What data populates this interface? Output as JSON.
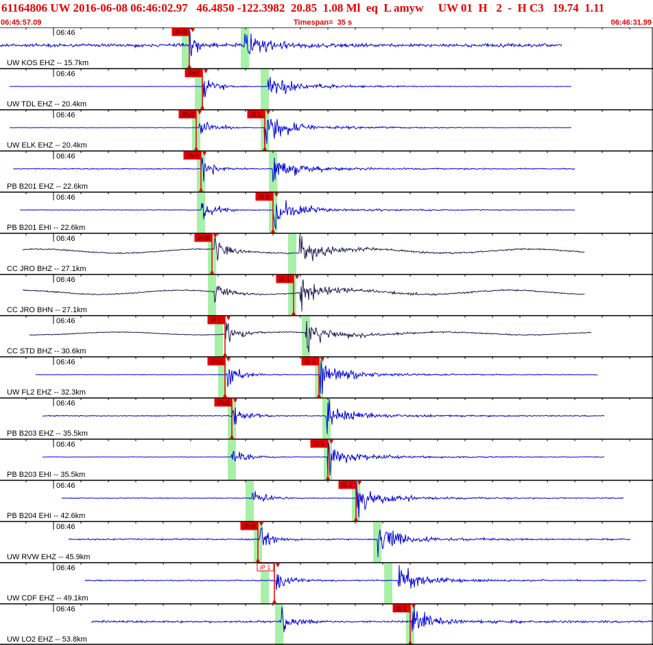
{
  "header": {
    "event_line": "61164806 UW 2016-06-08 06:46:02.97   46.4850 -122.3982  20.85  1.08 Ml  eq  L amyw     UW 01  H   2  -  H C3   19.74  1.11",
    "start_time": "06:45:57.09",
    "timespan": "Timespan=  35 s",
    "end_time": "06:46:31.99"
  },
  "colors": {
    "title_red": "#e60000",
    "trace_blue": "#0000dd",
    "trace_dark": "#1a1a50",
    "pick_red": "#e60000",
    "window_green": "#a8f0a8",
    "grid": "#000000"
  },
  "time_label": "06:46",
  "traces": [
    {
      "label": "UW KOS EHZ -- 15.7km",
      "color": "blue",
      "amp": 0.4,
      "start": 0.0,
      "end": 0.86,
      "p": 0.29,
      "s": 0.375,
      "picks": [
        {
          "text": "iPc0",
          "t": 0.29,
          "type": "P",
          "solid": true
        }
      ],
      "windows": [
        0.285,
        0.375
      ]
    },
    {
      "label": "UW TDL EHZ -- 20.4km",
      "color": "blue",
      "amp": 0.05,
      "start": 0.015,
      "end": 0.875,
      "p": 0.31,
      "s": 0.41,
      "picks": [
        {
          "text": "iPc0",
          "t": 0.31,
          "type": "P",
          "solid": true
        }
      ],
      "windows": [
        0.305,
        0.405
      ]
    },
    {
      "label": "UW ELK EHZ -- 20.4km",
      "color": "blue",
      "amp": 0.05,
      "start": 0.015,
      "end": 0.875,
      "p": 0.305,
      "s": 0.405,
      "picks": [
        {
          "text": "iPc0",
          "t": 0.3,
          "type": "P",
          "solid": true
        },
        {
          "text": "iS 1",
          "t": 0.405,
          "type": "S",
          "solid": true
        }
      ],
      "windows": [
        0.3,
        0.405
      ]
    },
    {
      "label": "PB B201 EHZ -- 22.6km",
      "color": "blue",
      "amp": 0.12,
      "start": 0.02,
      "end": 0.88,
      "p": 0.308,
      "s": 0.418,
      "picks": [
        {
          "text": "iPc0",
          "t": 0.308,
          "type": "P",
          "solid": true
        }
      ],
      "windows": [
        0.308,
        0.418
      ]
    },
    {
      "label": "PB B201 EHI -- 22.6km",
      "color": "blue",
      "amp": 0.07,
      "start": 0.03,
      "end": 0.88,
      "p": 0.308,
      "s": 0.418,
      "picks": [
        {
          "text": "iS 0",
          "t": 0.418,
          "type": "S",
          "solid": true
        }
      ],
      "windows": [
        0.308,
        0.418
      ]
    },
    {
      "label": "CC JRO BHZ -- 27.1km",
      "color": "dark",
      "amp": 0.15,
      "start": 0.035,
      "end": 0.895,
      "p": 0.328,
      "s": 0.458,
      "picks": [
        {
          "text": "iPc0",
          "t": 0.325,
          "type": "P",
          "solid": true
        }
      ],
      "windows": [
        0.325,
        0.448
      ]
    },
    {
      "label": "CC JRO BHN -- 27.1km",
      "color": "dark",
      "amp": 0.15,
      "start": 0.035,
      "end": 0.895,
      "p": 0.328,
      "s": 0.458,
      "picks": [
        {
          "text": "iS 1",
          "t": 0.45,
          "type": "S",
          "solid": true
        }
      ],
      "windows": [
        0.325,
        0.448
      ]
    },
    {
      "label": "CC STD BHZ -- 30.6km",
      "color": "dark",
      "amp": 0.1,
      "start": 0.045,
      "end": 0.905,
      "p": 0.345,
      "s": 0.468,
      "picks": [
        {
          "text": "iP 1",
          "t": 0.345,
          "type": "P",
          "solid": true
        }
      ],
      "windows": [
        0.335,
        0.468
      ]
    },
    {
      "label": "UW FL2 EHZ -- 32.3km",
      "color": "blue",
      "amp": 0.06,
      "start": 0.055,
      "end": 0.915,
      "p": 0.347,
      "s": 0.49,
      "picks": [
        {
          "text": "iPc0",
          "t": 0.345,
          "type": "P",
          "solid": true
        },
        {
          "text": "iS 1",
          "t": 0.488,
          "type": "S",
          "solid": true
        }
      ],
      "windows": [
        0.34,
        0.488
      ]
    },
    {
      "label": "PB B203 EHZ -- 35.5km",
      "color": "blue",
      "amp": 0.12,
      "start": 0.065,
      "end": 0.925,
      "p": 0.355,
      "s": 0.5,
      "picks": [
        {
          "text": "iPc0",
          "t": 0.355,
          "type": "P",
          "solid": true
        }
      ],
      "windows": [
        0.355,
        0.5
      ]
    },
    {
      "label": "PB B203 EHI -- 35.5km",
      "color": "blue",
      "amp": 0.04,
      "start": 0.065,
      "end": 0.925,
      "p": 0.355,
      "s": 0.502,
      "picks": [
        {
          "text": "iS 1",
          "t": 0.502,
          "type": "S",
          "solid": true
        }
      ],
      "windows": [
        0.355,
        0.502
      ]
    },
    {
      "label": "PB B204 EHI -- 42.6km",
      "color": "blue",
      "amp": 0.1,
      "start": 0.095,
      "end": 0.955,
      "p": 0.385,
      "s": 0.545,
      "picks": [
        {
          "text": "iS 1",
          "t": 0.545,
          "type": "S",
          "solid": true
        }
      ],
      "windows": [
        0.382,
        0.545
      ]
    },
    {
      "label": "UW RVW EHZ -- 45.9km",
      "color": "blue",
      "amp": 0.18,
      "start": 0.105,
      "end": 0.965,
      "p": 0.398,
      "s": 0.578,
      "picks": [
        {
          "text": "iPc0",
          "t": 0.395,
          "type": "P",
          "solid": true
        }
      ],
      "windows": [
        0.395,
        0.578
      ]
    },
    {
      "label": "UW CDF EHZ -- 49.1km",
      "color": "blue",
      "amp": 0.14,
      "start": 0.13,
      "end": 0.99,
      "p": 0.423,
      "s": 0.61,
      "picks": [
        {
          "text": "iP 1",
          "t": 0.42,
          "type": "P",
          "solid": false
        }
      ],
      "windows": [
        0.405,
        0.595
      ]
    },
    {
      "label": "UW LO2 EHZ -- 53.8km",
      "color": "blue",
      "amp": 0.25,
      "start": 0.14,
      "end": 1.0,
      "p": 0.43,
      "s": 0.63,
      "picks": [
        {
          "text": "iS 1",
          "t": 0.628,
          "type": "S",
          "solid": true
        }
      ],
      "windows": [
        0.428,
        0.628
      ]
    }
  ]
}
